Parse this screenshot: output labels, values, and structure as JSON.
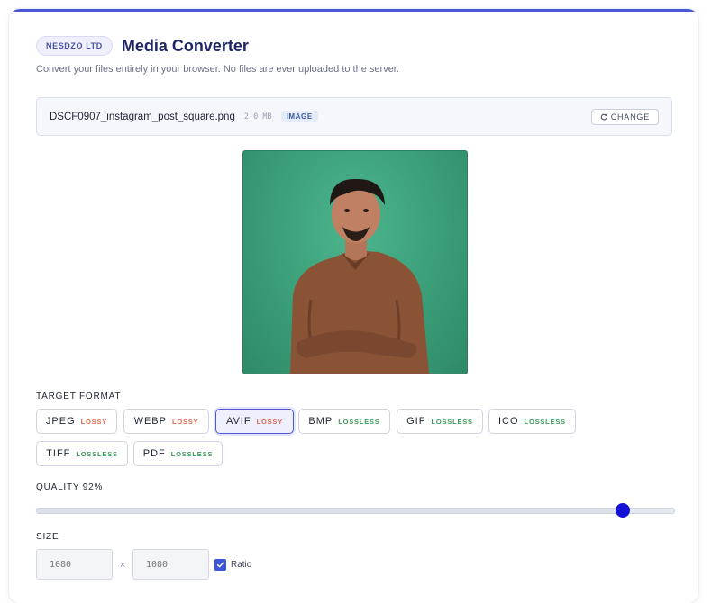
{
  "header": {
    "badge": "NESDZO LTD",
    "title": "Media Converter",
    "subtitle": "Convert your files entirely in your browser. No files are ever uploaded to the server."
  },
  "file": {
    "name": "DSCF0907_instagram_post_square.png",
    "size": "2.0 MB",
    "type": "IMAGE",
    "change_label": "CHANGE"
  },
  "target_format": {
    "label": "TARGET FORMAT",
    "formats": [
      {
        "name": "JPEG",
        "kind": "LOSSY"
      },
      {
        "name": "WEBP",
        "kind": "LOSSY"
      },
      {
        "name": "AVIF",
        "kind": "LOSSY"
      },
      {
        "name": "BMP",
        "kind": "LOSSLESS"
      },
      {
        "name": "GIF",
        "kind": "LOSSLESS"
      },
      {
        "name": "ICO",
        "kind": "LOSSLESS"
      },
      {
        "name": "TIFF",
        "kind": "LOSSLESS"
      },
      {
        "name": "PDF",
        "kind": "LOSSLESS"
      }
    ],
    "selected": "AVIF"
  },
  "quality": {
    "label": "QUALITY 92%",
    "value": 92
  },
  "size": {
    "label": "SIZE",
    "width": "1080",
    "height": "1080",
    "separator": "×",
    "ratio_label": "Ratio",
    "ratio_checked": true
  },
  "colors": {
    "accent": "#4a57d6",
    "slider_thumb": "#1510d6",
    "lossy": "#e0674f",
    "lossless": "#3d9a5b"
  }
}
